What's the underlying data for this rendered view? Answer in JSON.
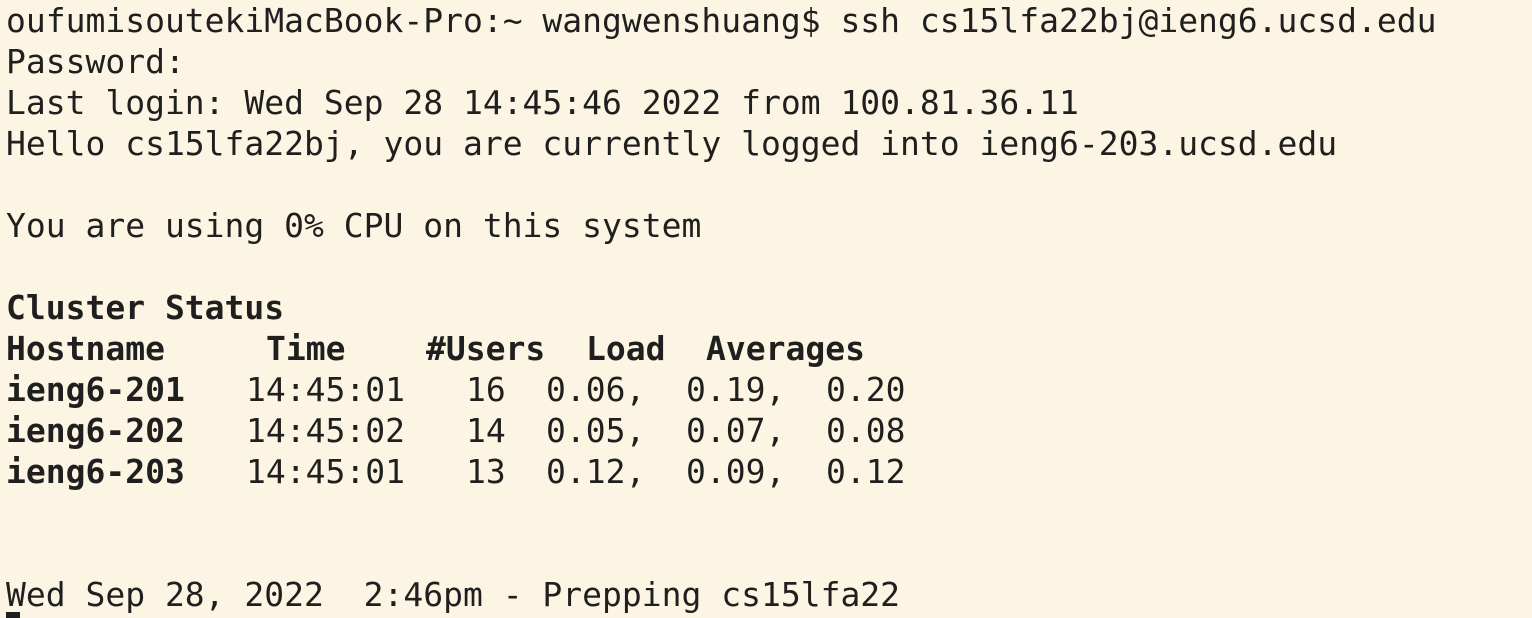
{
  "terminal": {
    "lines": {
      "ssh_command": "oufumisoutekiMacBook-Pro:~ wangwenshuang$ ssh cs15lfa22bj@ieng6.ucsd.edu",
      "password_prompt": "Password:",
      "last_login": "Last login: Wed Sep 28 14:45:46 2022 from 100.81.36.11",
      "hello": "Hello cs15lfa22bj, you are currently logged into ieng6-203.ucsd.edu",
      "cpu_usage": "You are using 0% CPU on this system",
      "cluster_status_heading": "Cluster Status",
      "prep_message": "Wed Sep 28, 2022  2:46pm - Prepping cs15lfa22"
    },
    "cluster_table": {
      "headers": {
        "hostname": "Hostname",
        "time": "Time",
        "users": "#Users",
        "load": "Load",
        "averages": "Averages"
      },
      "rows": [
        {
          "hostname": "ieng6-201",
          "time": "14:45:01",
          "users": "16",
          "load_1": "0.06,",
          "load_5": "0.19,",
          "load_15": "0.20"
        },
        {
          "hostname": "ieng6-202",
          "time": "14:45:02",
          "users": "14",
          "load_1": "0.05,",
          "load_5": "0.07,",
          "load_15": "0.08"
        },
        {
          "hostname": "ieng6-203",
          "time": "14:45:01",
          "users": "13",
          "load_1": "0.12,",
          "load_5": "0.09,",
          "load_15": "0.12"
        }
      ]
    }
  },
  "colors": {
    "background": "#fcf5e3",
    "text": "#1f1f1f"
  }
}
